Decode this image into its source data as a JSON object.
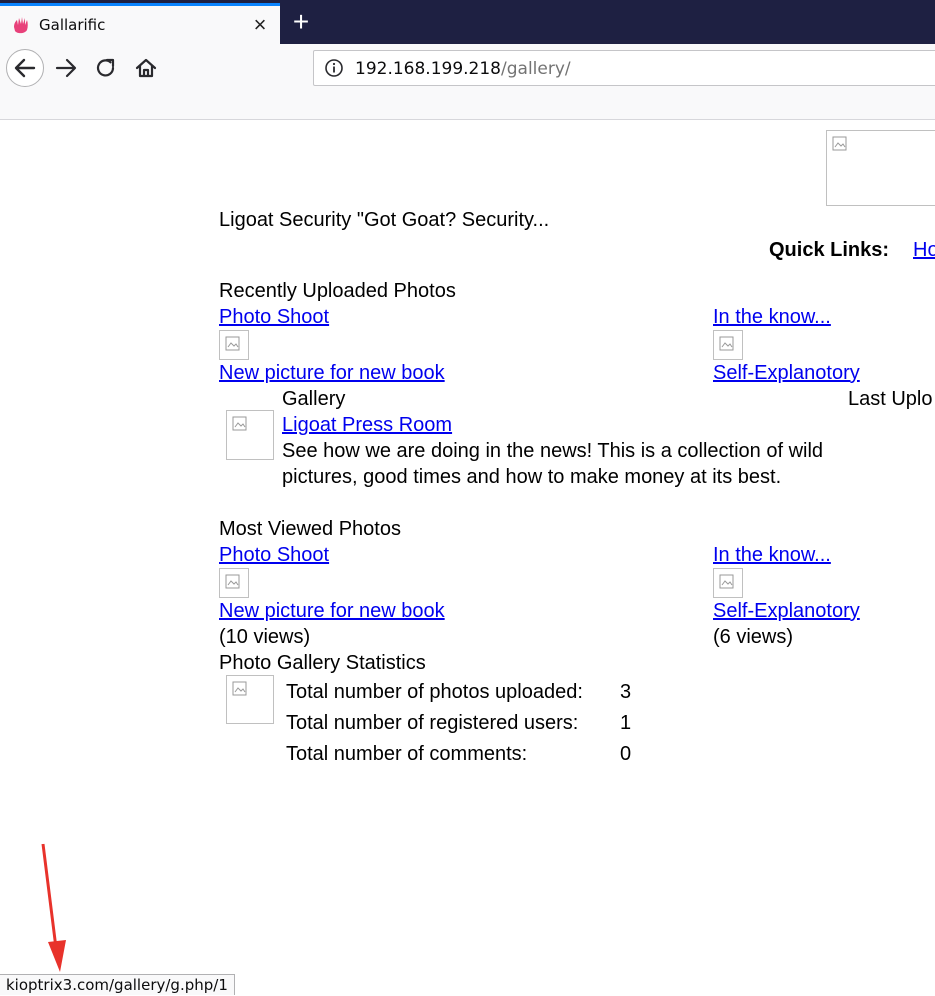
{
  "browser": {
    "tab_title": "Gallarific",
    "tab_close_icon": "close-icon",
    "new_tab_symbol": "+",
    "url_host": "192.168.199.218",
    "url_path": "/gallery/",
    "status_url": "kioptrix3.com/gallery/g.php/1"
  },
  "page": {
    "site_title": "Ligoat Security \"Got Goat? Security...",
    "quick_links_label": "Quick Links:",
    "quick_links_first": "Ho",
    "recent": {
      "heading": "Recently Uploaded Photos",
      "items": [
        {
          "album": "Photo Shoot",
          "title": "New picture for new book"
        },
        {
          "album": "In the know...",
          "title": "Self-Explanotory"
        }
      ]
    },
    "gallery": {
      "heading": "Gallery",
      "last_upload_label": "Last Uplo",
      "item_title": "Ligoat Press Room",
      "item_desc": "See how we are doing in the news! This is a collection of wild pictures, good times and how to make money at its best."
    },
    "most_viewed": {
      "heading": "Most Viewed Photos",
      "items": [
        {
          "album": "Photo Shoot",
          "title": "New picture for new book",
          "views": "(10 views)"
        },
        {
          "album": "In the know...",
          "title": "Self-Explanotory",
          "views": "(6 views)"
        }
      ]
    },
    "stats": {
      "heading": "Photo Gallery Statistics",
      "rows": [
        {
          "label": "Total number of photos uploaded:",
          "value": "3"
        },
        {
          "label": "Total number of registered users:",
          "value": "1"
        },
        {
          "label": "Total number of comments:",
          "value": "0"
        }
      ]
    }
  },
  "colors": {
    "link": "#0000ee",
    "tabbar": "#1e2042",
    "tab_accent": "#0a84ff",
    "annotation_arrow": "#e8322b"
  }
}
